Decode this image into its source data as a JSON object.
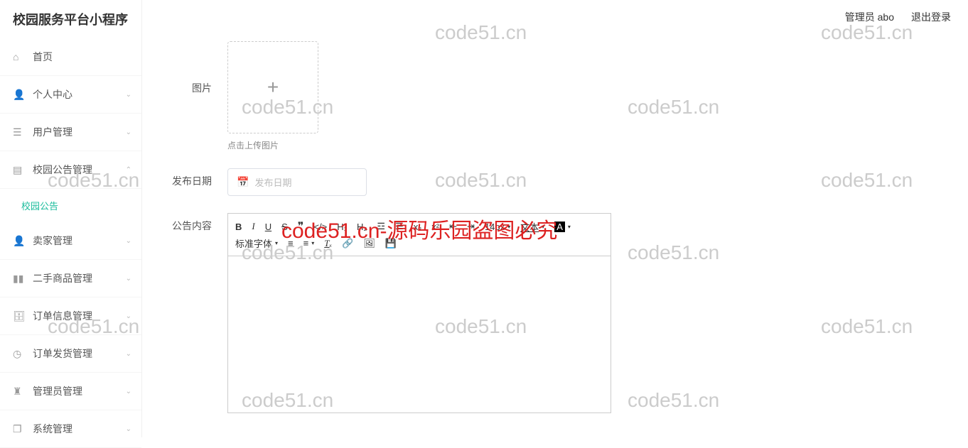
{
  "app": {
    "title": "校园服务平台小程序"
  },
  "topbar": {
    "admin_label": "管理员 abo",
    "logout": "退出登录"
  },
  "sidebar": {
    "items": [
      {
        "label": "首页",
        "icon": "home"
      },
      {
        "label": "个人中心",
        "icon": "user",
        "expandable": true
      },
      {
        "label": "用户管理",
        "icon": "list",
        "expandable": true
      },
      {
        "label": "校园公告管理",
        "icon": "doc",
        "expandable": true,
        "expanded": true,
        "children": [
          {
            "label": "校园公告"
          }
        ]
      },
      {
        "label": "卖家管理",
        "icon": "user",
        "expandable": true
      },
      {
        "label": "二手商品管理",
        "icon": "bar",
        "expandable": true
      },
      {
        "label": "订单信息管理",
        "icon": "case",
        "expandable": true
      },
      {
        "label": "订单发货管理",
        "icon": "clock",
        "expandable": true
      },
      {
        "label": "管理员管理",
        "icon": "admin",
        "expandable": true
      },
      {
        "label": "系统管理",
        "icon": "copy",
        "expandable": true
      }
    ]
  },
  "form": {
    "image_label": "图片",
    "upload_hint": "点击上传图片",
    "date_label": "发布日期",
    "date_placeholder": "发布日期",
    "content_label": "公告内容"
  },
  "editor": {
    "font_size": "14px",
    "font_color": "文本",
    "font_family": "标准字体",
    "buttons": [
      "bold",
      "italic",
      "underline",
      "strike",
      "quote",
      "code",
      "h1",
      "h2",
      "ol",
      "ul",
      "sub",
      "sup",
      "indent-dec",
      "indent-inc",
      "align",
      "clear",
      "link",
      "image",
      "save"
    ]
  },
  "watermarks": {
    "text": "code51.cn",
    "red": "code51.cn-源码乐园盗图必究"
  }
}
